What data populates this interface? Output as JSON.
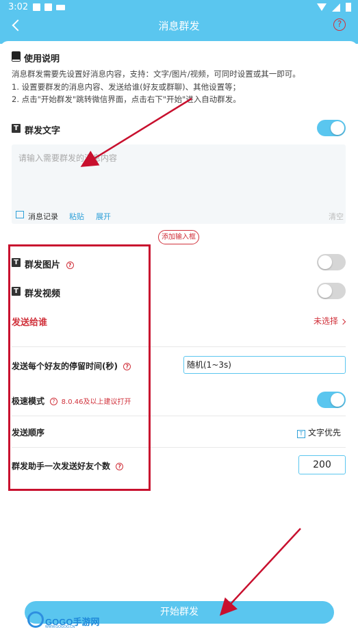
{
  "status_bar": {
    "time": "3:02"
  },
  "appbar": {
    "title": "消息群发",
    "help_glyph": "?"
  },
  "instructions": {
    "title": "使用说明",
    "lines": [
      "消息群发需要先设置好消息内容，支持：文字/图片/视频，可同时设置或其一即可。",
      "1. 设置要群发的消息内容、发送给谁(好友或群聊)、其他设置等；",
      "2. 点击\"开始群发\"跳转微信界面，点击右下\"开始\"进入自动群发。"
    ]
  },
  "text_section": {
    "title": "群发文字",
    "enabled": true,
    "placeholder": "请输入需要群发的消息内容",
    "tools": {
      "history": "消息记录",
      "paste": "粘贴",
      "expand": "展开",
      "clear": "清空"
    }
  },
  "add_input_button": "添加输入框",
  "image_section": {
    "title": "群发图片",
    "enabled": false
  },
  "video_section": {
    "title": "群发视频",
    "enabled": false
  },
  "send_to": {
    "label": "发送给谁",
    "value": "未选择"
  },
  "stay_time": {
    "label": "发送每个好友的停留时间(秒)",
    "value": "随机(1~3s)"
  },
  "speed_mode": {
    "label": "极速模式",
    "hint": "8.0.46及以上建议打开",
    "enabled": true
  },
  "send_order": {
    "label": "发送顺序",
    "value": "文字优先",
    "icon_glyph": "T"
  },
  "batch_count": {
    "label": "群发助手一次发送好友个数",
    "value": "200"
  },
  "start_button": "开始群发",
  "watermark": {
    "text": "GOGO手游网",
    "sub": "WWW.GOGOG.CN"
  },
  "colors": {
    "accent": "#5ac6ef",
    "red": "#d0303a",
    "annotation": "#c8102e"
  }
}
